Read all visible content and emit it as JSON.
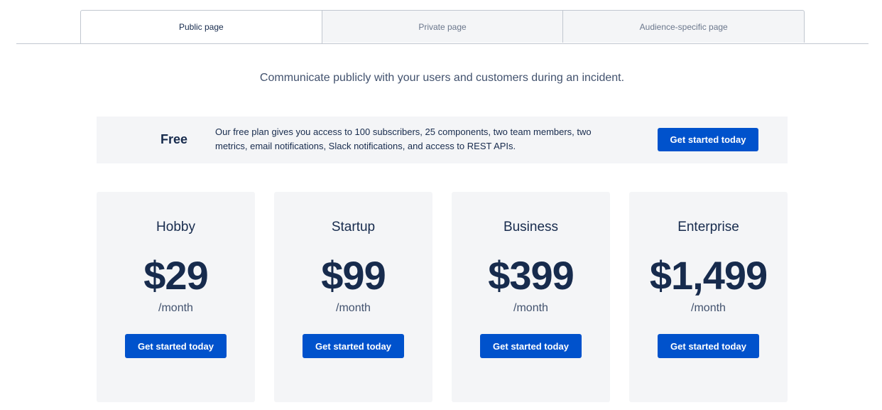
{
  "tabs": [
    {
      "label": "Public page",
      "active": true
    },
    {
      "label": "Private page",
      "active": false
    },
    {
      "label": "Audience-specific page",
      "active": false
    }
  ],
  "subtitle": "Communicate publicly with your users and customers during an incident.",
  "free_plan": {
    "title": "Free",
    "description": "Our free plan gives you access to 100 subscribers, 25 components, two team members, two metrics, email notifications, Slack notifications, and access to REST APIs.",
    "button_label": "Get started today"
  },
  "plans": [
    {
      "name": "Hobby",
      "price": "$29",
      "period": "/month",
      "button_label": "Get started today"
    },
    {
      "name": "Startup",
      "price": "$99",
      "period": "/month",
      "button_label": "Get started today"
    },
    {
      "name": "Business",
      "price": "$399",
      "period": "/month",
      "button_label": "Get started today"
    },
    {
      "name": "Enterprise",
      "price": "$1,499",
      "period": "/month",
      "button_label": "Get started today"
    }
  ],
  "colors": {
    "accent": "#0052cc",
    "text": "#172b4d",
    "panel": "#f4f5f7"
  }
}
